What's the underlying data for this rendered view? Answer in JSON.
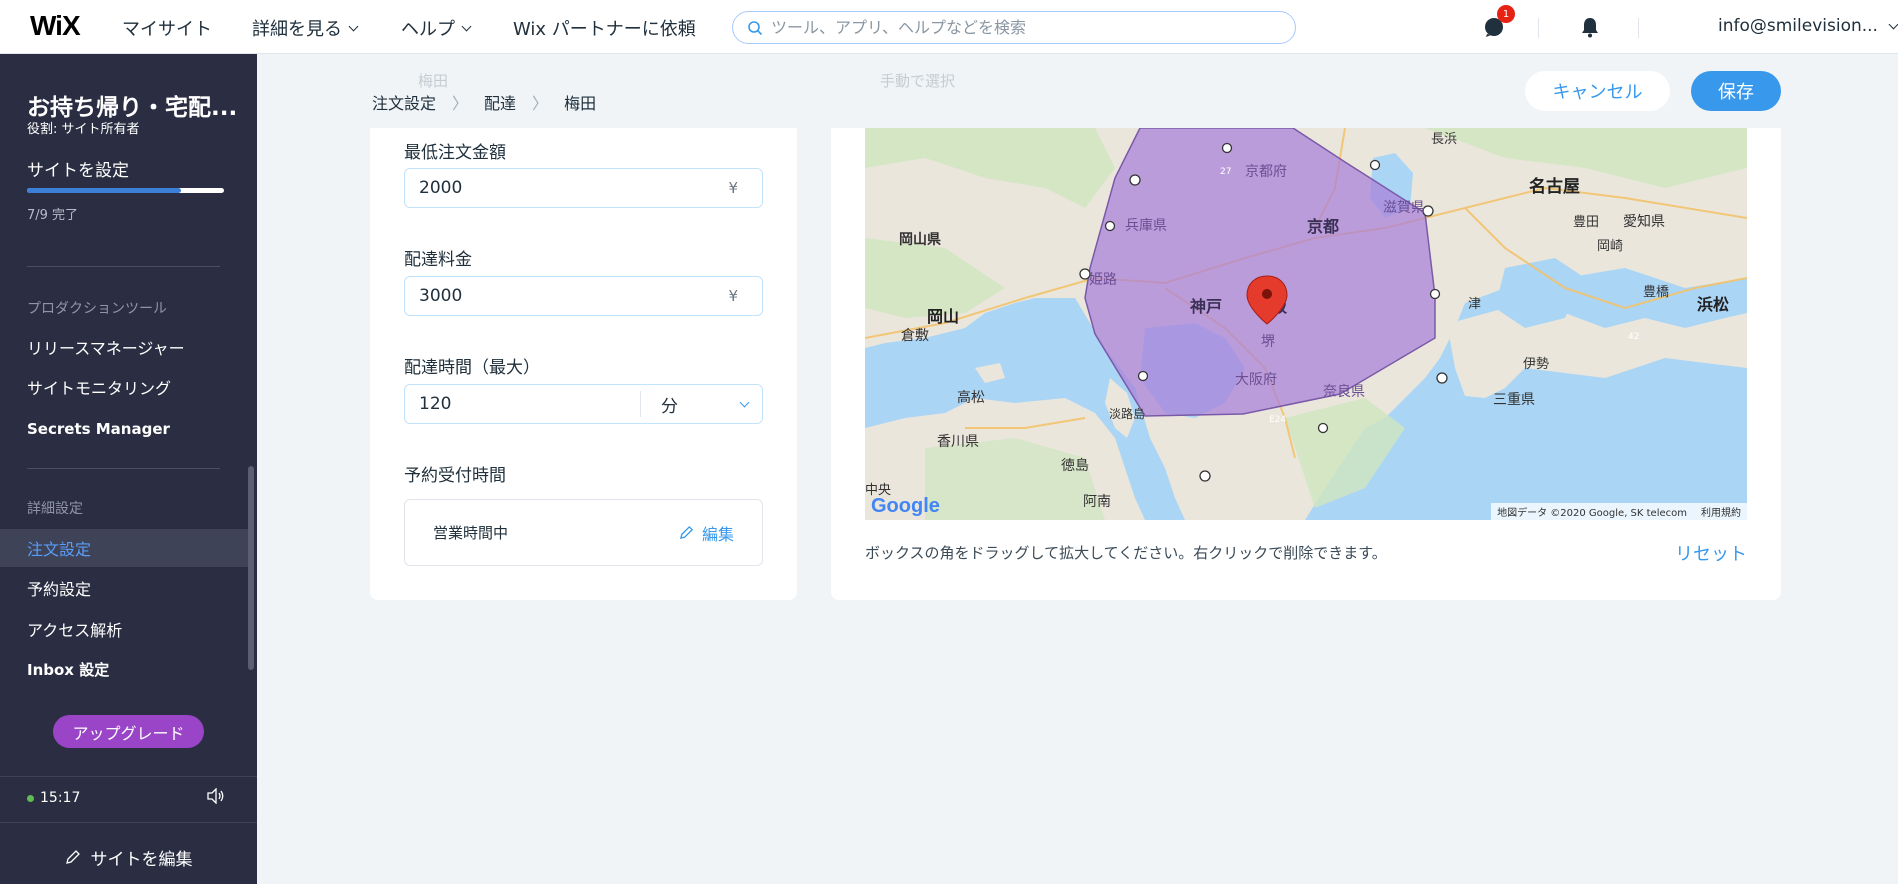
{
  "topbar": {
    "logo": "WiX",
    "nav": [
      "マイサイト",
      "詳細を見る",
      "ヘルプ",
      "Wix パートナーに依頼"
    ],
    "search_placeholder": "ツール、アプリ、ヘルプなどを検索",
    "notification_count": "1",
    "account": "info@smilevision..."
  },
  "sidebar": {
    "site_name": "お持ち帰り・宅配...",
    "role": "役割: サイト所有者",
    "setup_label": "サイトを設定",
    "progress_text": "7/9 完了",
    "progress_fraction": 0.78,
    "section_production": "プロダクションツール",
    "production_items": [
      "リリースマネージャー",
      "サイトモニタリング",
      "Secrets Manager"
    ],
    "section_advanced": "詳細設定",
    "advanced_items": [
      "注文設定",
      "予約設定",
      "アクセス解析",
      "Inbox 設定"
    ],
    "upgrade": "アップグレード",
    "time": "15:17",
    "edit_site": "サイトを編集"
  },
  "breadcrumb": [
    "注文設定",
    "配達",
    "梅田"
  ],
  "ghost_texts": {
    "left": "梅田",
    "right": "手動で選択"
  },
  "actions": {
    "cancel": "キャンセル",
    "save": "保存"
  },
  "form": {
    "min_order_label": "最低注文金額",
    "min_order_value": "2000",
    "currency": "¥",
    "delivery_fee_label": "配達料金",
    "delivery_fee_value": "3000",
    "delivery_time_label": "配達時間（最大）",
    "delivery_time_value": "120",
    "delivery_time_unit": "分",
    "reservation_label": "予約受付時間",
    "hours_status": "営業時間中",
    "edit": "編集"
  },
  "map": {
    "hint": "ボックスの角をドラッグして拡大してください。右クリックで削除できます。",
    "reset": "リセット",
    "attribution": "地図データ ©2020 Google, SK telecom",
    "terms": "利用規約",
    "google": "Google",
    "polygon_color": "#a97fd9",
    "labels": {
      "kyoto_pref": "京都府",
      "hyogo": "兵庫県",
      "kyoto": "京都",
      "shiga": "滋賀県",
      "okayama_pref": "岡山県",
      "okayama": "岡山",
      "kurashiki": "倉敷",
      "himeji": "姫路",
      "kobe": "神戸",
      "osaka": "大阪",
      "sakai": "堺",
      "osaka_pref": "大阪府",
      "nara": "奈良県",
      "takamatsu": "高松",
      "kagawa": "香川県",
      "awaji": "淡路島",
      "tokushima": "徳島",
      "anan": "阿南",
      "nagahama": "長浜",
      "nagoya": "名古屋",
      "toyota": "豊田",
      "aichi": "愛知県",
      "okazaki": "岡崎",
      "toyohashi": "豊橋",
      "hamamatsu": "浜松",
      "tsu": "津",
      "ise": "伊勢",
      "mie": "三重県",
      "chuo": "中央",
      "road_27": "27",
      "road_42": "42",
      "road_e24": "E24"
    }
  }
}
